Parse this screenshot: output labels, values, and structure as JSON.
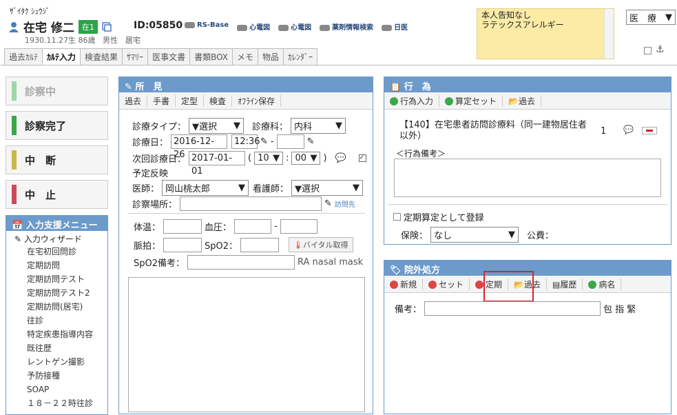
{
  "patient": {
    "kana": "ｻﾞｲﾀｸ ｼｭｳｼﾞ",
    "name": "在宅 修二",
    "status_badge": "在1",
    "birth": "1930.11.27生 86歳",
    "sex": "男性",
    "residence": "居宅",
    "id": "ID:05850"
  },
  "header_links": [
    "RS-Base",
    "心電図",
    "心電図",
    "薬剤情報検索",
    "日医"
  ],
  "note": {
    "line1": "本人告知なし",
    "line2": "ラテックスアレルギー"
  },
  "department_select": "医　療",
  "tabs": [
    "過去ｶﾙﾃ",
    "ｶﾙﾃ入力",
    "検査結果",
    "ｻﾏﾘｰ",
    "医事文書",
    "書類BOX",
    "メモ",
    "物品",
    "ｶﾚﾝﾀﾞｰ"
  ],
  "status_buttons": [
    {
      "label": "診察中",
      "color": "#9fd7a7"
    },
    {
      "label": "診察完了",
      "color": "#3aa84a"
    },
    {
      "label": "中　断",
      "color": "#c9b84a"
    },
    {
      "label": "中　止",
      "color": "#cc4a5a"
    }
  ],
  "input_menu": {
    "title": "入力支援メニュー",
    "wizard": "入力ウィザード",
    "items": [
      "在宅初回問診",
      "定期訪問",
      "定期訪問テスト",
      "定期訪問テスト2",
      "定期訪問(居宅)",
      "往診",
      "特定疾患指導内容",
      "既往歴",
      "レントゲン撮影",
      "予防接種",
      "SOAP",
      "１８－２２時往診"
    ]
  },
  "shoken": {
    "title": "所　見",
    "tools": [
      "過去",
      "手書",
      "定型",
      "検査",
      "ｵﾌﾗｲﾝ保存"
    ],
    "type_label": "診療タイプ：",
    "type_value": "▼選択",
    "dept_label": "診療科：",
    "dept_value": "内科",
    "date_label": "診療日：",
    "date_value": "2016-12-26",
    "time_value": "12:36",
    "dash": "-",
    "next_label": "次回診療日：",
    "next_value": "2017-01-01",
    "open_paren": "(",
    "next_hour": "10",
    "colon": ":",
    "next_min": "00",
    "close_paren": ")",
    "reflect_label": "予定反映",
    "doctor_label": "医師：",
    "doctor_value": "岡山桃太郎",
    "nurse_label": "看護師：",
    "nurse_value": "▼選択",
    "place_label": "診察場所：",
    "visit_label": "訪問先",
    "temp_label": "体温：",
    "bp_label": "血圧：",
    "bp_dash": "-",
    "pulse_label": "脈拍：",
    "spo2_label": "SpO2：",
    "vital_button": "バイタル取得",
    "spo2_note_label": "SpO2備考：",
    "spo2_note_suffix": "RA nasal mask"
  },
  "koui": {
    "title": "行　為",
    "tools": [
      "行為入力",
      "算定セット",
      "過去"
    ],
    "item": "【140】在宅患者訪問診療料（同一建物居住者以外）",
    "qty": "1",
    "note_label": "＜行為備考＞",
    "teiki_label": "定期算定として登録",
    "insurance_label": "保険：",
    "insurance_value": "なし",
    "public_label": "公費："
  },
  "ingai": {
    "title": "院外処方",
    "tools": [
      "新規",
      "セット",
      "定期",
      "過去",
      "履歴",
      "病名"
    ],
    "remark_label": "備考：",
    "remark_suffix": "包 指 緊"
  }
}
